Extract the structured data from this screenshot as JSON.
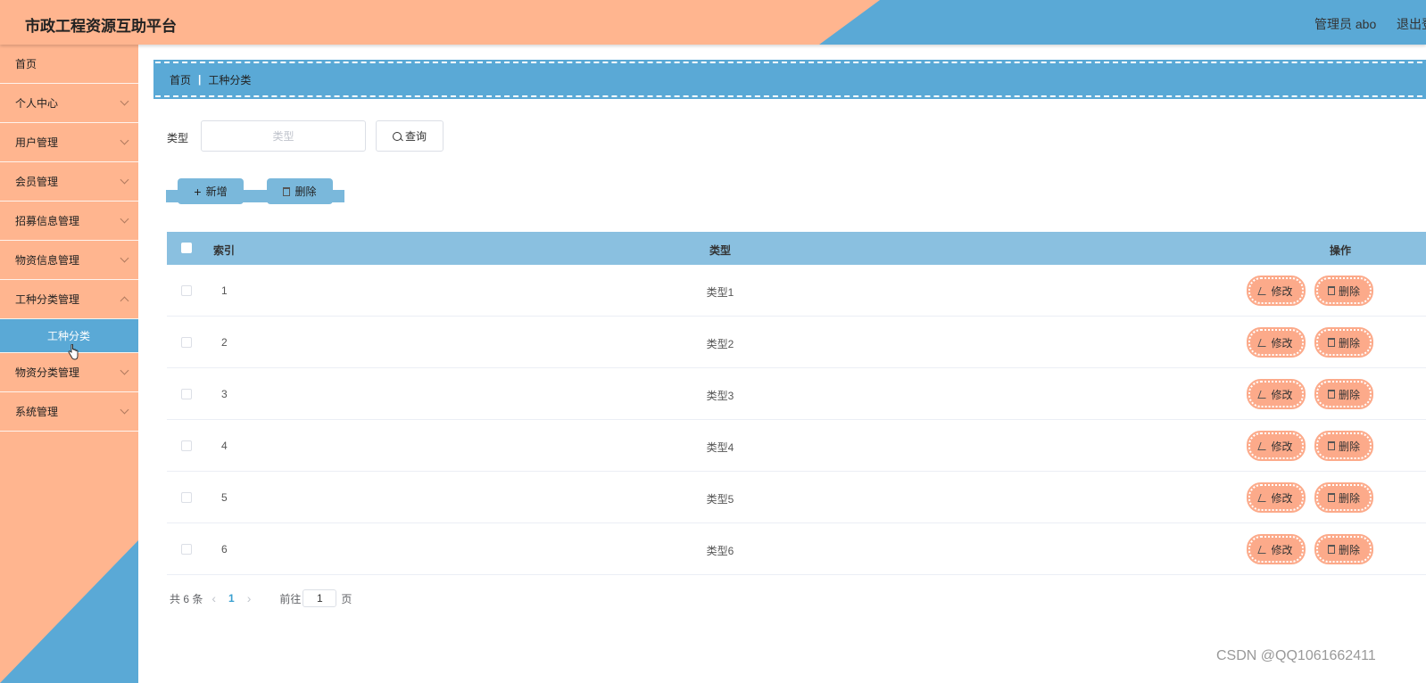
{
  "header": {
    "title": "市政工程资源互助平台",
    "user": "管理员 abo",
    "logout": "退出登录"
  },
  "sidebar": {
    "items": [
      {
        "label": "首页",
        "has_children": false
      },
      {
        "label": "个人中心",
        "has_children": true
      },
      {
        "label": "用户管理",
        "has_children": true
      },
      {
        "label": "会员管理",
        "has_children": true
      },
      {
        "label": "招募信息管理",
        "has_children": true
      },
      {
        "label": "物资信息管理",
        "has_children": true
      },
      {
        "label": "工种分类管理",
        "has_children": true,
        "expanded": true,
        "children": [
          {
            "label": "工种分类",
            "active": true
          }
        ]
      },
      {
        "label": "物资分类管理",
        "has_children": true
      },
      {
        "label": "系统管理",
        "has_children": true
      }
    ]
  },
  "breadcrumb": {
    "home": "首页",
    "current": "工种分类"
  },
  "search": {
    "label": "类型",
    "placeholder": "类型",
    "button": "查询"
  },
  "actions": {
    "add": "新增",
    "delete": "删除"
  },
  "table": {
    "headers": {
      "index": "索引",
      "type": "类型",
      "operation": "操作"
    },
    "rows": [
      {
        "index": "1",
        "type": "类型1"
      },
      {
        "index": "2",
        "type": "类型2"
      },
      {
        "index": "3",
        "type": "类型3"
      },
      {
        "index": "4",
        "type": "类型4"
      },
      {
        "index": "5",
        "type": "类型5"
      },
      {
        "index": "6",
        "type": "类型6"
      }
    ],
    "edit_label": "修改",
    "delete_label": "删除"
  },
  "pagination": {
    "total": "共 6 条",
    "current_page": "1",
    "goto_prefix": "前往",
    "goto_value": "1",
    "goto_suffix": "页"
  },
  "watermark": "CSDN @QQ1061662411",
  "colors": {
    "peach": "#ffb58f",
    "blue": "#5aa9d6",
    "light_blue": "#8ac0e0",
    "button_peach": "#fcaa8a"
  }
}
